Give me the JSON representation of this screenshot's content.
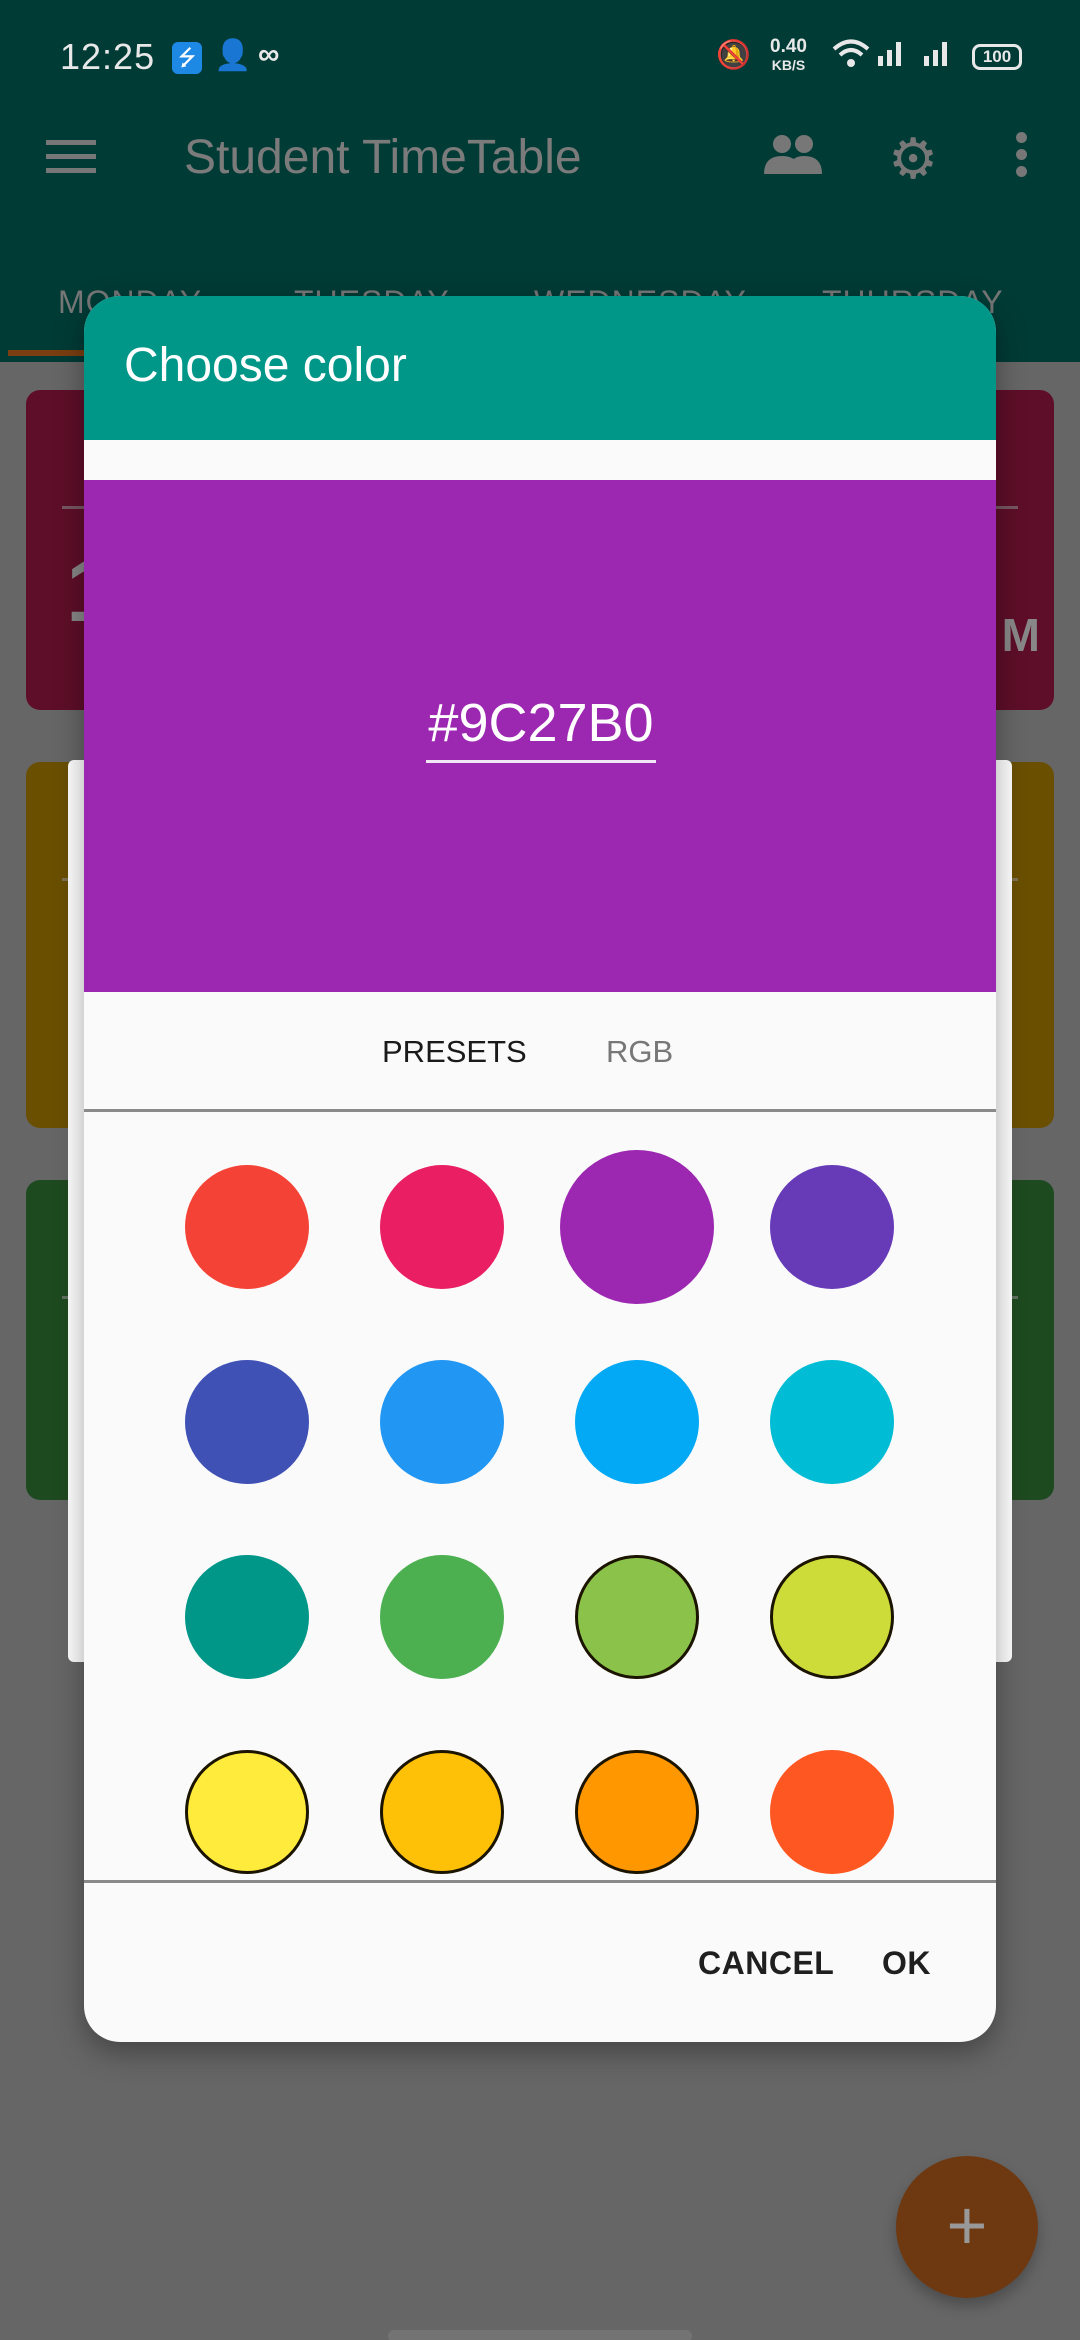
{
  "status_bar": {
    "time": "12:25",
    "left_icons": [
      "usb-debug-icon",
      "add-contact-icon",
      "loop-icon"
    ],
    "net_speed_value": "0.40",
    "net_speed_unit": "KB/S",
    "right_icons": [
      "vibrate-silent-icon",
      "wifi-icon",
      "signal-1-icon",
      "signal-2-icon"
    ],
    "battery": "100"
  },
  "app_bar": {
    "title": "Student TimeTable",
    "tabs": [
      {
        "label": "MONDAY",
        "selected": true
      },
      {
        "label": "TUESDAY",
        "selected": false
      },
      {
        "label": "WEDNESDAY",
        "selected": false
      },
      {
        "label": "THURSDAY",
        "selected": false
      }
    ]
  },
  "background_cards": {
    "card1_partial_text": "1",
    "card1_partial_ampm": "M"
  },
  "fab": {
    "glyph": "+"
  },
  "dialog": {
    "title": "Choose color",
    "selected_hex": "#9C27B0",
    "selected_color": "#9C27B0",
    "header_color": "#009688",
    "tabs": [
      {
        "label": "PRESETS",
        "active": true
      },
      {
        "label": "RGB",
        "active": false
      }
    ],
    "swatches": [
      {
        "color": "#F44336",
        "bordered": false,
        "selected": false
      },
      {
        "color": "#E91E63",
        "bordered": false,
        "selected": false
      },
      {
        "color": "#9C27B0",
        "bordered": false,
        "selected": true
      },
      {
        "color": "#673AB7",
        "bordered": false,
        "selected": false
      },
      {
        "color": "#3F51B5",
        "bordered": false,
        "selected": false
      },
      {
        "color": "#2196F3",
        "bordered": false,
        "selected": false
      },
      {
        "color": "#03A9F4",
        "bordered": false,
        "selected": false
      },
      {
        "color": "#00BCD4",
        "bordered": false,
        "selected": false
      },
      {
        "color": "#009688",
        "bordered": false,
        "selected": false
      },
      {
        "color": "#4CAF50",
        "bordered": false,
        "selected": false
      },
      {
        "color": "#8BC34A",
        "bordered": true,
        "selected": false
      },
      {
        "color": "#CDDC39",
        "bordered": true,
        "selected": false
      },
      {
        "color": "#FFEB3B",
        "bordered": true,
        "selected": false
      },
      {
        "color": "#FFC107",
        "bordered": true,
        "selected": false
      },
      {
        "color": "#FF9800",
        "bordered": true,
        "selected": false
      },
      {
        "color": "#FF5722",
        "bordered": false,
        "selected": false
      }
    ],
    "cancel_label": "CANCEL",
    "ok_label": "OK"
  }
}
